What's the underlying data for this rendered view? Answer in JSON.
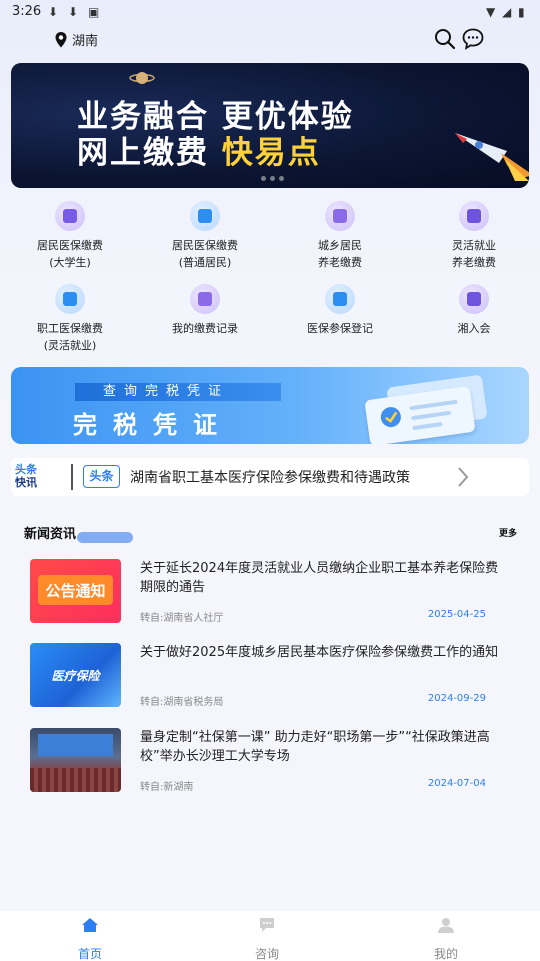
{
  "status_bar": {
    "time": "3:26"
  },
  "header": {
    "location": "湖南"
  },
  "banner": {
    "line1": "业务融合 更优体验",
    "line2_prefix": "网上缴费 ",
    "line2_highlight": "快易点"
  },
  "services": [
    {
      "label_line1": "居民医保缴费",
      "label_line2": "(大学生)",
      "icon": "graduation-cap-icon"
    },
    {
      "label_line1": "居民医保缴费",
      "label_line2": "(普通居民)",
      "icon": "payment-icon"
    },
    {
      "label_line1": "城乡居民",
      "label_line2": "养老缴费",
      "icon": "pension-icon"
    },
    {
      "label_line1": "灵活就业",
      "label_line2": "养老缴费",
      "icon": "briefcase-icon"
    },
    {
      "label_line1": "职工医保缴费",
      "label_line2": "(灵活就业)",
      "icon": "medical-bottle-icon"
    },
    {
      "label_line1": "我的缴费记录",
      "label_line2": "",
      "icon": "record-icon"
    },
    {
      "label_line1": "医保参保登记",
      "label_line2": "",
      "icon": "medical-plus-icon"
    },
    {
      "label_line1": "湘入会",
      "label_line2": "",
      "icon": "home-globe-icon"
    }
  ],
  "tax_banner": {
    "subtitle": "查询完税凭证",
    "title": "完税凭证"
  },
  "headline": {
    "brand_top": "头条",
    "brand_bottom": "快讯",
    "tag": "头条",
    "text": "湖南省职工基本医疗保险参保缴费和待遇政策"
  },
  "news": {
    "section_title": "新闻资讯",
    "more_label": "更多",
    "items": [
      {
        "title": "关于延长2024年度灵活就业人员缴纳企业职工基本养老保险费期限的通告",
        "source": "转自:湖南省人社厅",
        "date": "2025-04-25",
        "thumb_text": "公告通知"
      },
      {
        "title": "关于做好2025年度城乡居民基本医疗保险参保缴费工作的通知",
        "source": "转自:湖南省税务局",
        "date": "2024-09-29",
        "thumb_text": "医疗保险"
      },
      {
        "title": "量身定制“社保第一课” 助力走好“职场第一步”“社保政策进高校”举办长沙理工大学专场",
        "source": "转自:新湖南",
        "date": "2024-07-04",
        "thumb_text": ""
      }
    ]
  },
  "bottom_nav": [
    {
      "label": "首页",
      "active": true
    },
    {
      "label": "咨询",
      "active": false
    },
    {
      "label": "我的",
      "active": false
    }
  ],
  "colors": {
    "accent": "#2d7ef2",
    "banner_highlight": "#ffd23a"
  }
}
